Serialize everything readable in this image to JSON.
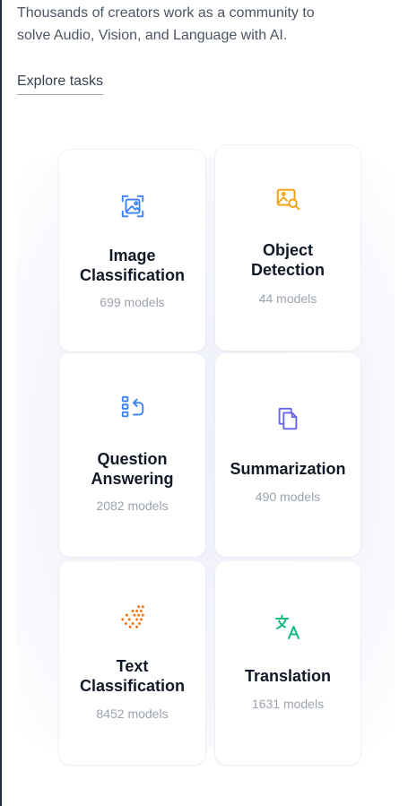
{
  "intro": {
    "line1": "Thousands of creators work as a community to",
    "line2": "solve Audio, Vision, and Language with AI."
  },
  "explore_link": "Explore tasks",
  "tasks": [
    {
      "title_line1": "Image",
      "title_line2": "Classification",
      "count": "699 models",
      "icon": "image-classification-icon",
      "color": "#3b82f6"
    },
    {
      "title_line1": "Object",
      "title_line2": "Detection",
      "count": "44 models",
      "icon": "object-detection-icon",
      "color": "#f59e0b"
    },
    {
      "title_line1": "Question",
      "title_line2": "Answering",
      "count": "2082 models",
      "icon": "question-answering-icon",
      "color": "#3b82f6"
    },
    {
      "title_line1": "Summarization",
      "title_line2": "",
      "count": "490 models",
      "icon": "summarization-icon",
      "color": "#6366f1"
    },
    {
      "title_line1": "Text",
      "title_line2": "Classification",
      "count": "8452 models",
      "icon": "text-classification-icon",
      "color": "#f97316"
    },
    {
      "title_line1": "Translation",
      "title_line2": "",
      "count": "1631 models",
      "icon": "translation-icon",
      "color": "#10b981"
    }
  ]
}
